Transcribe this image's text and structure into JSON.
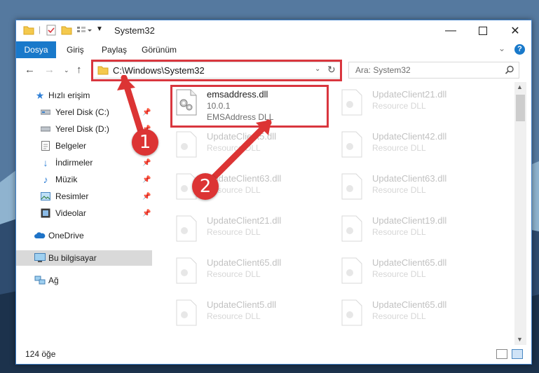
{
  "window": {
    "title": "System32"
  },
  "ribbon": {
    "tabs": [
      "Dosya",
      "Giriş",
      "Paylaş",
      "Görünüm"
    ]
  },
  "address": {
    "path": "C:\\Windows\\System32"
  },
  "search": {
    "placeholder": "Ara: System32"
  },
  "nav": {
    "items": [
      {
        "label": "Hızlı erişim",
        "icon": "star-icon"
      },
      {
        "label": "Yerel Disk (C:)",
        "icon": "drive-icon",
        "pinned": true
      },
      {
        "label": "Yerel Disk (D:)",
        "icon": "drive-icon",
        "pinned": true
      },
      {
        "label": "Belgeler",
        "icon": "documents-icon",
        "pinned": true
      },
      {
        "label": "İndirmeler",
        "icon": "download-icon",
        "pinned": true
      },
      {
        "label": "Müzik",
        "icon": "music-icon",
        "pinned": true
      },
      {
        "label": "Resimler",
        "icon": "pictures-icon",
        "pinned": true
      },
      {
        "label": "Videolar",
        "icon": "videos-icon",
        "pinned": true
      },
      {
        "label": "OneDrive",
        "icon": "cloud-icon"
      },
      {
        "label": "Bu bilgisayar",
        "icon": "computer-icon",
        "selected": true
      },
      {
        "label": "Ağ",
        "icon": "network-icon"
      }
    ]
  },
  "files": {
    "highlighted": {
      "name": "emsaddress.dll",
      "version": "10.0.1",
      "description": "EMSAddress DLL"
    },
    "left": [
      {
        "name": "UpdateClient5.dll",
        "description": "Resource DLL"
      },
      {
        "name": "UpdateClient63.dll",
        "description": "Resource DLL"
      },
      {
        "name": "UpdateClient21.dll",
        "description": "Resource DLL"
      },
      {
        "name": "UpdateClient65.dll",
        "description": "Resource DLL"
      },
      {
        "name": "UpdateClient5.dll",
        "description": "Resource DLL"
      }
    ],
    "right": [
      {
        "name": "UpdateClient21.dll",
        "description": "Resource DLL"
      },
      {
        "name": "UpdateClient42.dll",
        "description": "Resource DLL"
      },
      {
        "name": "UpdateClient63.dll",
        "description": "Resource DLL"
      },
      {
        "name": "UpdateClient19.dll",
        "description": "Resource DLL"
      },
      {
        "name": "UpdateClient65.dll",
        "description": "Resource DLL"
      },
      {
        "name": "UpdateClient65.dll",
        "description": "Resource DLL"
      }
    ]
  },
  "status": {
    "count": "124 öğe"
  },
  "callouts": {
    "one": "1",
    "two": "2"
  },
  "colors": {
    "accent": "#1979ca",
    "callout": "#dc3434",
    "highlight_border": "#d9363e"
  }
}
